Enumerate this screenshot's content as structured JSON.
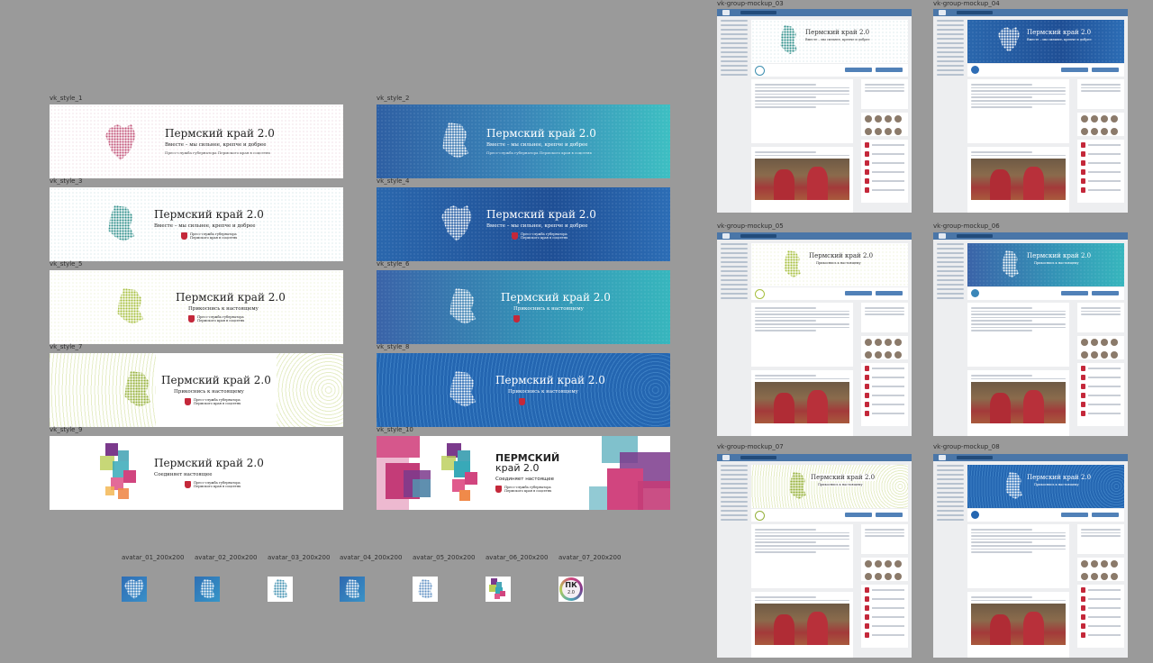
{
  "canvas": {
    "background": "#9a9a9a"
  },
  "banners": [
    {
      "label": "vk_style_1",
      "title": "Пермский край 2.0",
      "subtitle": "Вместе – мы сильнее, крепче и добрее",
      "subtitle2": "Пресс-служба губернатора Пермского края в соцсетях",
      "press": ""
    },
    {
      "label": "vk_style_2",
      "title": "Пермский край 2.0",
      "subtitle": "Вместе – мы сильнее, крепче и добрее",
      "subtitle2": "Пресс-служба губернатора Пермского края в соцсетях",
      "press": ""
    },
    {
      "label": "vk_style_3",
      "title": "Пермский край 2.0",
      "subtitle": "Вместе – мы сильнее, крепче и добрее",
      "subtitle2": "",
      "press": "Пресс-служба губернатора Пермского края в соцсетях"
    },
    {
      "label": "vk_style_4",
      "title": "Пермский край 2.0",
      "subtitle": "Вместе – мы сильнее, крепче и добрее",
      "subtitle2": "",
      "press": "Пресс-служба губернатора Пермского края в соцсетях"
    },
    {
      "label": "vk_style_5",
      "title": "Пермский край 2.0",
      "subtitle": "Прикоснись к настоящему",
      "subtitle2": "",
      "press": "Пресс-служба губернатора Пермского края в соцсетях"
    },
    {
      "label": "vk_style_6",
      "title": "Пермский край 2.0",
      "subtitle": "Прикоснись к настоящему",
      "subtitle2": "",
      "press": ""
    },
    {
      "label": "vk_style_7",
      "title": "Пермский край 2.0",
      "subtitle": "Прикоснись к настоящему",
      "subtitle2": "",
      "press": "Пресс-служба губернатора Пермского края в соцсетях"
    },
    {
      "label": "vk_style_8",
      "title": "Пермский край 2.0",
      "subtitle": "Прикоснись к настоящему",
      "subtitle2": "",
      "press": ""
    },
    {
      "label": "vk_style_9",
      "title": "Пермский край 2.0",
      "subtitle": "Соединяет настоящее",
      "subtitle2": "",
      "press": "Пресс-служба губернатора Пермского края в соцсетях"
    },
    {
      "label": "vk_style_10",
      "title": "ПЕРМСКИЙ",
      "title2": "край 2.0",
      "subtitle": "Соединяет настоящее",
      "subtitle2": "",
      "press": "Пресс-служба губернатора Пермского края в соцсетях"
    }
  ],
  "avatars": [
    {
      "label": "avatar_01_200x200"
    },
    {
      "label": "avatar_02_200x200"
    },
    {
      "label": "avatar_03_200x200"
    },
    {
      "label": "avatar_04_200x200"
    },
    {
      "label": "avatar_05_200x200"
    },
    {
      "label": "avatar_06_200x200"
    },
    {
      "label": "avatar_07_200x200",
      "mark": "ПК",
      "mark2": "2.0"
    }
  ],
  "mockups": [
    {
      "label": "vk-group-mockup_03",
      "title": "Пермский край 2.0",
      "subtitle": "Вместе – мы сильнее, крепче и добрее"
    },
    {
      "label": "vk-group-mockup_04",
      "title": "Пермский край 2.0",
      "subtitle": "Вместе – мы сильнее, крепче и добрее"
    },
    {
      "label": "vk-group-mockup_05",
      "title": "Пермский край 2.0",
      "subtitle": "Прикоснись к настоящему"
    },
    {
      "label": "vk-group-mockup_06",
      "title": "Пермский край 2.0",
      "subtitle": "Прикоснись к настоящему"
    },
    {
      "label": "vk-group-mockup_07",
      "title": "Пермский край 2.0",
      "subtitle": "Прикоснись к настоящему"
    },
    {
      "label": "vk-group-mockup_08",
      "title": "Пермский край 2.0",
      "subtitle": "Прикоснись к настоящему"
    }
  ],
  "colors": {
    "blue_banner": "#2f6fb0",
    "teal_banner": "#38a7b8",
    "vk_blue": "#4a76a8",
    "crest_red": "#c4283a",
    "pink": "#d1457f",
    "green": "#a8c050"
  }
}
